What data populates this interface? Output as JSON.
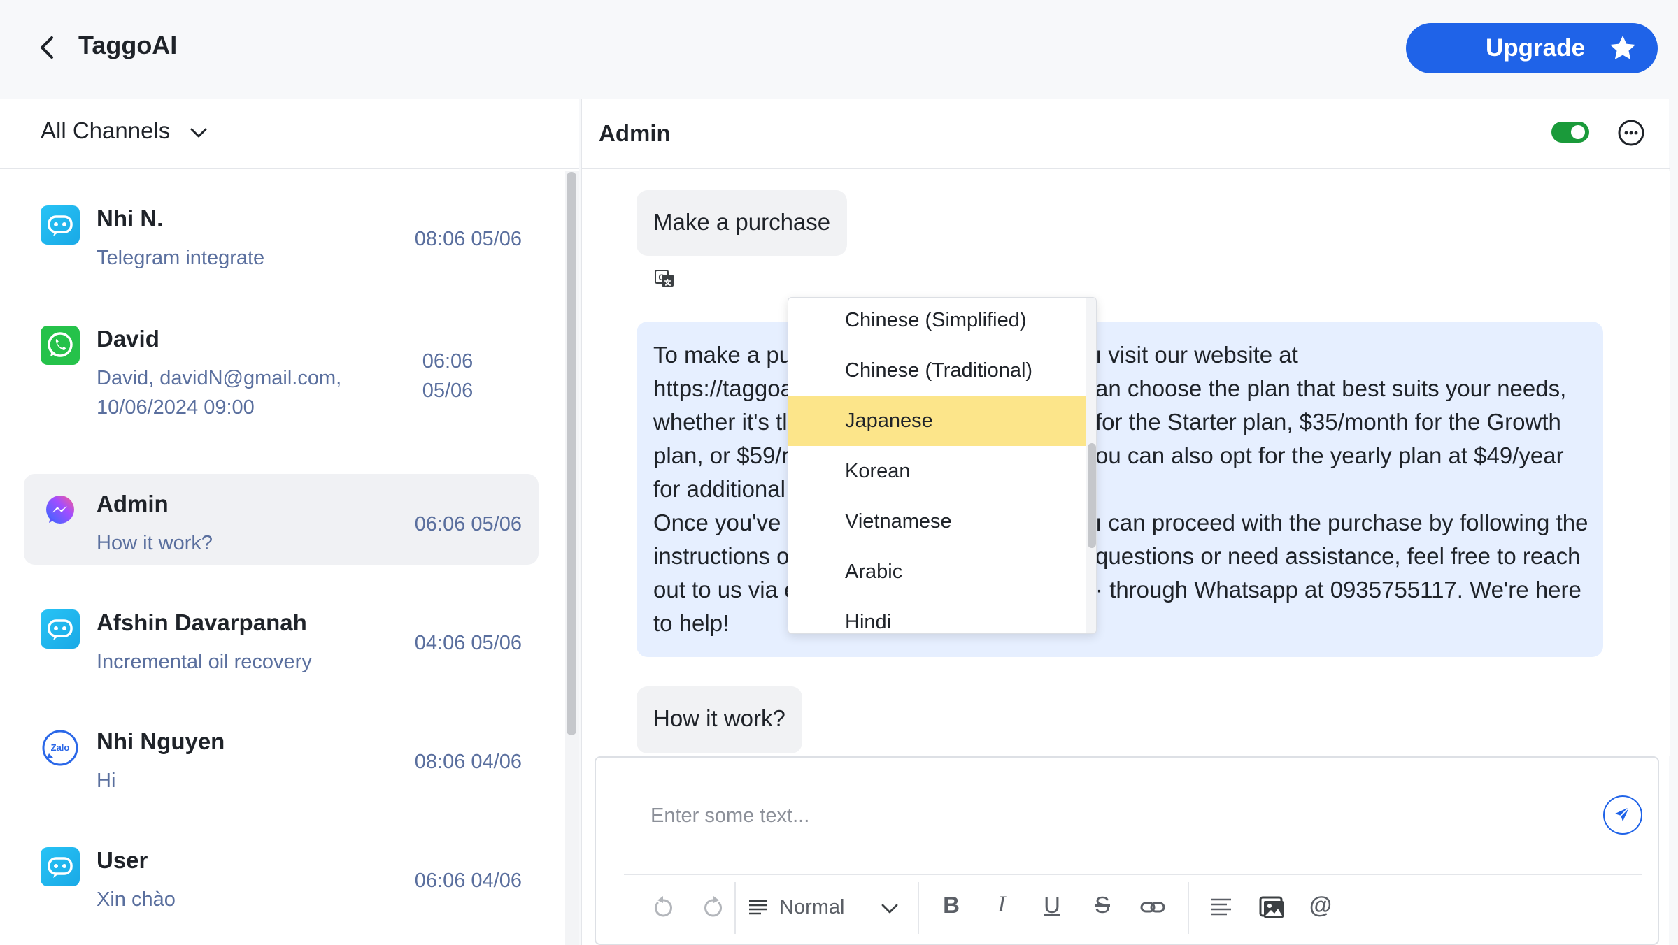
{
  "app": {
    "title": "TaggoAI",
    "upgrade_label": "Upgrade"
  },
  "sidebar": {
    "filter_label": "All Channels",
    "conversations": [
      {
        "name": "Nhi N.",
        "preview": "Telegram integrate",
        "time": "08:06 05/06",
        "channel": "chatbot"
      },
      {
        "name": "David",
        "preview": "David, davidN@gmail.com, 10/06/2024 09:00",
        "time": "06:06 05/06",
        "channel": "whatsapp"
      },
      {
        "name": "Admin",
        "preview": "How it work?",
        "time": "06:06 05/06",
        "channel": "messenger",
        "active": true
      },
      {
        "name": "Afshin Davarpanah",
        "preview": "Incremental oil recovery",
        "time": "04:06 05/06",
        "channel": "chatbot"
      },
      {
        "name": "Nhi Nguyen",
        "preview": "Hi",
        "time": "08:06 04/06",
        "channel": "zalo"
      },
      {
        "name": "User",
        "preview": "Xin chào",
        "time": "06:06 04/06",
        "channel": "chatbot"
      }
    ],
    "zalo_badge": "Zalo"
  },
  "chat": {
    "title": "Admin",
    "toggle_on": true,
    "messages": [
      {
        "from": "user",
        "text": "Make a purchase"
      },
      {
        "from": "bot",
        "lines": [
          "To make a pu",
          "https://taggoa",
          "whether it's tl",
          "plan, or $59/r",
          "for additional",
          "Once you've s",
          "instructions o",
          "out to us via e",
          "to help!"
        ],
        "lines_right": [
          "ı visit our website at",
          "an choose the plan that best suits your needs,",
          "for the Starter plan, $35/month for the Growth",
          "ou can also opt for the yearly plan at $49/year",
          "",
          "ı can proceed with the purchase by following the",
          "questions or need assistance, feel free to reach",
          "· through Whatsapp at 0935755117. We're here",
          ""
        ]
      },
      {
        "from": "user",
        "text": "How it work?"
      }
    ],
    "language_menu": {
      "options": [
        "Chinese (Simplified)",
        "Chinese (Traditional)",
        "Japanese",
        "Korean",
        "Vietnamese",
        "Arabic",
        "Hindi"
      ],
      "selected": "Japanese"
    },
    "composer": {
      "placeholder": "Enter some text...",
      "format_label": "Normal",
      "toolbar": [
        "undo-icon",
        "redo-icon",
        "paragraph-icon",
        "bold",
        "italic",
        "underline",
        "strikethrough",
        "link-icon",
        "align-left-icon",
        "image-icon",
        "mention"
      ],
      "bold_glyph": "B",
      "italic_glyph": "I",
      "underline_glyph": "U",
      "strike_glyph": "S",
      "mention_glyph": "@"
    }
  },
  "colors": {
    "accent": "#1f63e8",
    "toggle_on": "#1a9a3a",
    "selected_option": "#fce58a",
    "bot_bubble": "#e6efff",
    "muted_text": "#5a6f9e"
  }
}
